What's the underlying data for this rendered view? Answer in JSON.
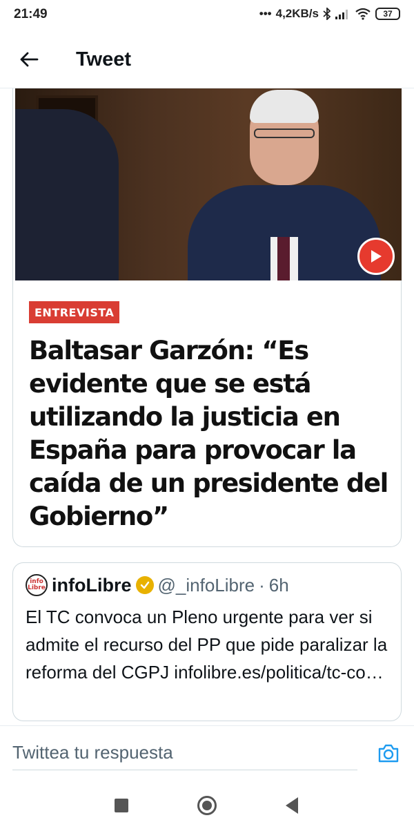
{
  "status_bar": {
    "time": "21:49",
    "network_speed": "4,2KB/s",
    "battery": "37",
    "icons": [
      "bluetooth-icon",
      "signal-icon",
      "wifi-icon",
      "battery-icon"
    ]
  },
  "header": {
    "title": "Tweet",
    "back_icon": "arrow-left-icon"
  },
  "article": {
    "tag": "ENTREVISTA",
    "headline": "Baltasar Garzón: “Es evidente que se está utilizando la justicia en España para provocar la caída de un presidente del Gobierno”",
    "play_icon": "play-icon",
    "tag_color": "#d93d33",
    "play_color": "#e63a2e"
  },
  "quoted_tweet": {
    "avatar_text_line1": "info",
    "avatar_text_line2": "Libre",
    "name": "infoLibre",
    "handle": "@_infoLibre",
    "separator": "·",
    "time": "6h",
    "text": "El TC convoca un Pleno urgente para ver si admite el recurso del PP que pide paralizar la reforma del CGPJ infolibre.es/politica/tc-co…",
    "verified_color": "#e8b100"
  },
  "reply": {
    "placeholder": "Twittea tu respuesta",
    "camera_icon": "camera-icon",
    "accent": "#1d9bf0"
  },
  "nav": {
    "icons": [
      "recent-apps-icon",
      "home-icon",
      "back-icon"
    ]
  }
}
